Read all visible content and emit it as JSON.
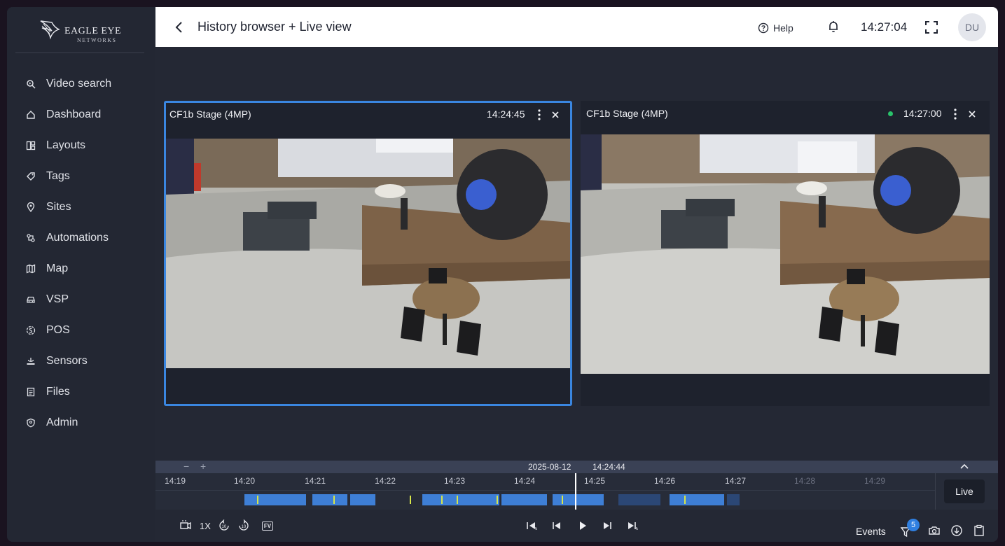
{
  "brand": {
    "name": "EAGLE EYE",
    "sub": "NETWORKS"
  },
  "sidebar": {
    "items": [
      {
        "label": "Video search",
        "icon": "video-search-icon"
      },
      {
        "label": "Dashboard",
        "icon": "home-icon"
      },
      {
        "label": "Layouts",
        "icon": "layouts-icon"
      },
      {
        "label": "Tags",
        "icon": "tag-icon"
      },
      {
        "label": "Sites",
        "icon": "location-icon"
      },
      {
        "label": "Automations",
        "icon": "automation-icon"
      },
      {
        "label": "Map",
        "icon": "map-icon"
      },
      {
        "label": "VSP",
        "icon": "car-icon"
      },
      {
        "label": "POS",
        "icon": "pos-icon"
      },
      {
        "label": "Sensors",
        "icon": "sensor-icon"
      },
      {
        "label": "Files",
        "icon": "files-icon"
      },
      {
        "label": "Admin",
        "icon": "admin-icon"
      }
    ]
  },
  "header": {
    "title": "History browser + Live view",
    "help": "Help",
    "clock": "14:27:04",
    "avatar": "DU"
  },
  "tiles": [
    {
      "title": "CF1b Stage (4MP)",
      "time": "14:24:45",
      "mode": "history"
    },
    {
      "title": "CF1b Stage (4MP)",
      "time": "14:27:00",
      "mode": "live"
    }
  ],
  "timeline": {
    "date": "2025-08-12",
    "time": "14:24:44",
    "zoom_out": "−",
    "zoom_in": "+",
    "ticks": [
      "14:19",
      "14:20",
      "14:21",
      "14:22",
      "14:23",
      "14:24",
      "14:25",
      "14:26",
      "14:27",
      "14:28",
      "14:29"
    ],
    "live_label": "Live"
  },
  "controls": {
    "speed": "1X",
    "fv": "FV",
    "events_label": "Events",
    "events_count": "5"
  },
  "colors": {
    "accent": "#3a86e0",
    "recording": "#3e7fd6",
    "event_marker": "#d7e64a",
    "live_dot": "#29c26a"
  }
}
